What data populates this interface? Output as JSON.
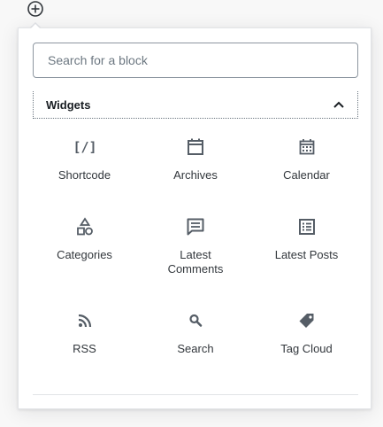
{
  "inserter": {
    "toggle_icon": "plus-circle-icon",
    "search": {
      "placeholder": "Search for a block",
      "value": ""
    },
    "panel": {
      "title": "Widgets",
      "expanded": true,
      "chevron_icon": "chevron-up-icon"
    },
    "blocks": [
      {
        "label": "Shortcode",
        "icon": "shortcode-icon"
      },
      {
        "label": "Archives",
        "icon": "calendar-archive-icon"
      },
      {
        "label": "Calendar",
        "icon": "calendar-icon"
      },
      {
        "label": "Categories",
        "icon": "categories-icon"
      },
      {
        "label": "Latest Comments",
        "icon": "comment-icon"
      },
      {
        "label": "Latest Posts",
        "icon": "list-icon"
      },
      {
        "label": "RSS",
        "icon": "rss-icon"
      },
      {
        "label": "Search",
        "icon": "search-icon"
      },
      {
        "label": "Tag Cloud",
        "icon": "tag-icon"
      }
    ]
  },
  "colors": {
    "border": "#e2e4e7",
    "icon": "#555d66",
    "text": "#32373c",
    "input_border": "#8d96a0"
  }
}
